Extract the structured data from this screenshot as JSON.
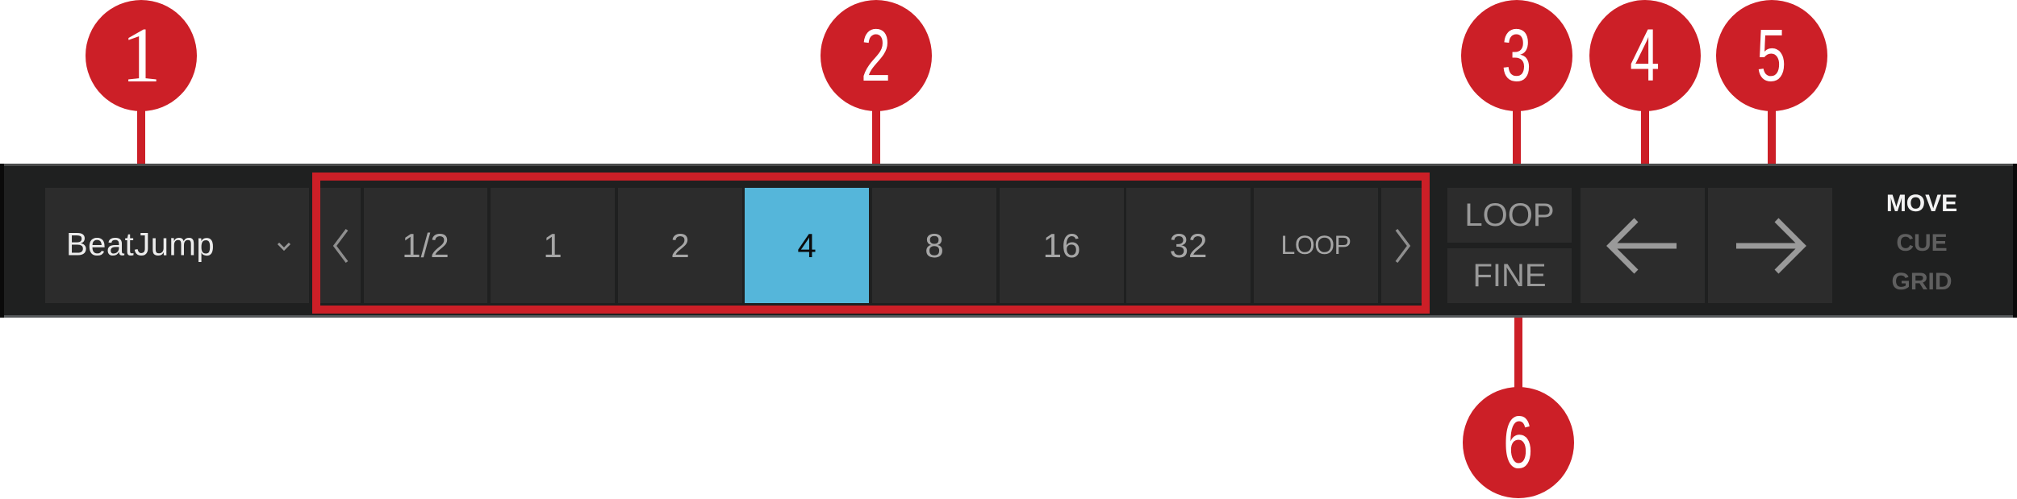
{
  "toolbar": {
    "mode_dropdown": {
      "value": "BeatJump",
      "icon": "chevron-down-icon"
    },
    "jump_sizes": {
      "prev_icon": "chevron-left-icon",
      "next_icon": "chevron-right-icon",
      "items": [
        {
          "label": "1/2",
          "active": false
        },
        {
          "label": "1",
          "active": false
        },
        {
          "label": "2",
          "active": false
        },
        {
          "label": "4",
          "active": true
        },
        {
          "label": "8",
          "active": false
        },
        {
          "label": "16",
          "active": false
        },
        {
          "label": "32",
          "active": false
        },
        {
          "label": "LOOP",
          "active": false
        }
      ]
    },
    "loop_button": "LOOP",
    "fine_button": "FINE",
    "jump_back_icon": "arrow-left-icon",
    "jump_forward_icon": "arrow-right-icon",
    "move_modes": {
      "items": [
        {
          "label": "MOVE",
          "active": true
        },
        {
          "label": "CUE",
          "active": false
        },
        {
          "label": "GRID",
          "active": false
        }
      ]
    }
  },
  "callouts": [
    "1",
    "2",
    "3",
    "4",
    "5",
    "6"
  ],
  "colors": {
    "accent": "#55b6da",
    "callout_red": "#cc1f27",
    "bar_bg": "#1f2020",
    "cell_bg": "#2c2c2c"
  }
}
